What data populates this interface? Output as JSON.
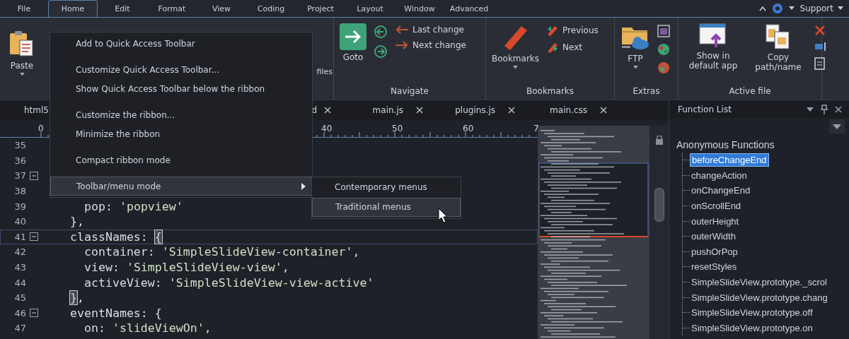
{
  "menubar": {
    "items": [
      {
        "label": "File",
        "selected": false
      },
      {
        "label": "Home",
        "selected": true
      },
      {
        "label": "Edit",
        "selected": false
      },
      {
        "label": "Format",
        "selected": false
      },
      {
        "label": "View",
        "selected": false
      },
      {
        "label": "Coding",
        "selected": false
      },
      {
        "label": "Project",
        "selected": false
      },
      {
        "label": "Layout",
        "selected": false
      },
      {
        "label": "Window",
        "selected": false
      },
      {
        "label": "Advanced",
        "selected": false
      }
    ],
    "support": "Support"
  },
  "ribbon": {
    "paste": "Paste",
    "fragment": "files",
    "groups": [
      {
        "label": "Navigate",
        "large": "Goto",
        "small": [
          "Last change",
          "Next change"
        ]
      },
      {
        "label": "Bookmarks",
        "large": "Bookmarks",
        "small": [
          "Previous",
          "Next"
        ]
      },
      {
        "label": "Extras",
        "large": "FTP"
      },
      {
        "label": "Active file",
        "buttons": [
          "Show in default app",
          "Copy path/name"
        ]
      }
    ]
  },
  "tabs": [
    {
      "label": "html5"
    },
    {
      "label": "d"
    },
    {
      "label": "main.js"
    },
    {
      "label": "plugins.js"
    },
    {
      "label": "main.css"
    }
  ],
  "ruler": [
    "0",
    "40",
    "50",
    "60",
    "7"
  ],
  "lines": [
    {
      "number": "35",
      "foldable": false,
      "current": false
    },
    {
      "number": "36",
      "foldable": false,
      "current": false
    },
    {
      "number": "37",
      "foldable": true,
      "current": false
    },
    {
      "number": "38",
      "foldable": false,
      "current": false
    },
    {
      "number": "39",
      "foldable": false,
      "current": false,
      "parts": [
        {
          "kind": "text",
          "text": "      pop: "
        },
        {
          "kind": "string",
          "text": "'popview'"
        }
      ]
    },
    {
      "number": "40",
      "foldable": false,
      "current": false,
      "parts": [
        {
          "kind": "text",
          "text": "    },"
        }
      ]
    },
    {
      "number": "41",
      "foldable": true,
      "current": true,
      "parts": [
        {
          "kind": "text",
          "text": "    classNames: "
        },
        {
          "kind": "bracket",
          "text": "{"
        }
      ]
    },
    {
      "number": "42",
      "foldable": false,
      "current": false,
      "parts": [
        {
          "kind": "text",
          "text": "      container: "
        },
        {
          "kind": "string",
          "text": "'SimpleSlideView-container'"
        },
        {
          "kind": "text",
          "text": ","
        }
      ]
    },
    {
      "number": "43",
      "foldable": false,
      "current": false,
      "parts": [
        {
          "kind": "text",
          "text": "      view: "
        },
        {
          "kind": "string",
          "text": "'SimpleSlideView-view'"
        },
        {
          "kind": "text",
          "text": ","
        }
      ]
    },
    {
      "number": "44",
      "foldable": false,
      "current": false,
      "parts": [
        {
          "kind": "text",
          "text": "      activeView: "
        },
        {
          "kind": "string",
          "text": "'SimpleSlideView-view-active'"
        }
      ]
    },
    {
      "number": "45",
      "foldable": false,
      "current": false,
      "parts": [
        {
          "kind": "bracket",
          "text": "    }"
        },
        {
          "kind": "text",
          "text": ","
        }
      ]
    },
    {
      "number": "46",
      "foldable": true,
      "current": false,
      "parts": [
        {
          "kind": "text",
          "text": "    eventNames: {"
        }
      ]
    },
    {
      "number": "47",
      "foldable": false,
      "current": false,
      "parts": [
        {
          "kind": "text",
          "text": "      on: "
        },
        {
          "kind": "string",
          "text": "'slideViewOn'"
        },
        {
          "kind": "text",
          "text": ","
        }
      ]
    }
  ],
  "function_list": {
    "title": "Function List",
    "root": {
      "label": "Anonymous Functions",
      "children": [
        {
          "label": "beforeChangeEnd",
          "selected": true
        },
        {
          "label": "changeAction",
          "selected": false
        },
        {
          "label": "onChangeEnd",
          "selected": false
        },
        {
          "label": "onScrollEnd",
          "selected": false
        },
        {
          "label": "outerHeight",
          "selected": false
        },
        {
          "label": "outerWidth",
          "selected": false
        },
        {
          "label": "pushOrPop",
          "selected": false
        },
        {
          "label": "resetStyles",
          "selected": false
        },
        {
          "label": "SimpleSlideView.prototype._scrol",
          "selected": false
        },
        {
          "label": "SimpleSlideView.prototype.chang",
          "selected": false
        },
        {
          "label": "SimpleSlideView.prototype.off",
          "selected": false
        },
        {
          "label": "SimpleSlideView.prototype.on",
          "selected": false
        }
      ]
    }
  },
  "context_menu": {
    "items": [
      {
        "kind": "item",
        "label": "Add to Quick Access Toolbar",
        "selected": false
      },
      {
        "kind": "separator"
      },
      {
        "kind": "item",
        "label": "Customize Quick Access Toolbar...",
        "selected": false
      },
      {
        "kind": "item",
        "label": "Show Quick Access Toolbar below the ribbon",
        "selected": false
      },
      {
        "kind": "separator"
      },
      {
        "kind": "item",
        "label": "Customize the ribbon...",
        "selected": false
      },
      {
        "kind": "item",
        "label": "Minimize the ribbon",
        "selected": false
      },
      {
        "kind": "separator"
      },
      {
        "kind": "item",
        "label": "Compact ribbon mode",
        "selected": false
      },
      {
        "kind": "separator"
      },
      {
        "kind": "submenu",
        "label": "Toolbar/menu mode",
        "selected": true
      }
    ],
    "submenu": [
      {
        "label": "Contemporary menus",
        "selected": false
      },
      {
        "label": "Traditional menus",
        "selected": true
      }
    ]
  }
}
